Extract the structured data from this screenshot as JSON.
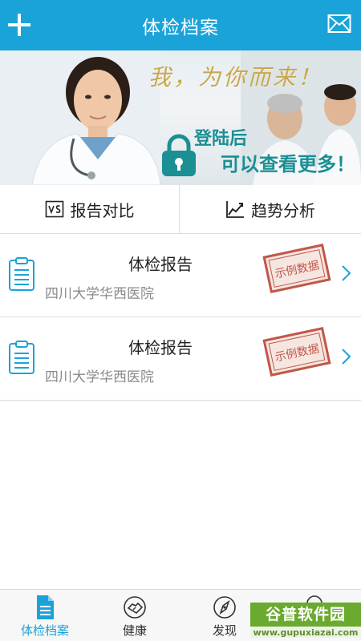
{
  "header": {
    "title": "体检档案"
  },
  "banner": {
    "slogan": "我，为你而来！",
    "login_line1": "登陆后",
    "login_line2": "可以查看更多！"
  },
  "tabs": {
    "compare": "报告对比",
    "trend": "趋势分析"
  },
  "reports": [
    {
      "title": "体检报告",
      "hospital": "四川大学华西医院",
      "stamp": "示例数据"
    },
    {
      "title": "体检报告",
      "hospital": "四川大学华西医院",
      "stamp": "示例数据"
    }
  ],
  "bottom_nav": [
    {
      "label": "体检档案",
      "icon": "document-icon",
      "active": true
    },
    {
      "label": "健康",
      "icon": "handshake-icon",
      "active": false
    },
    {
      "label": "发现",
      "icon": "compass-icon",
      "active": false
    },
    {
      "label": "",
      "icon": "profile-icon",
      "active": false
    }
  ],
  "watermark": {
    "main": "谷普软件园",
    "url": "www.gupuxiazai.com"
  },
  "colors": {
    "accent": "#1aa3d8",
    "login_text": "#1a8f94",
    "stamp": "#c0574a",
    "slogan": "#c9a84a"
  }
}
